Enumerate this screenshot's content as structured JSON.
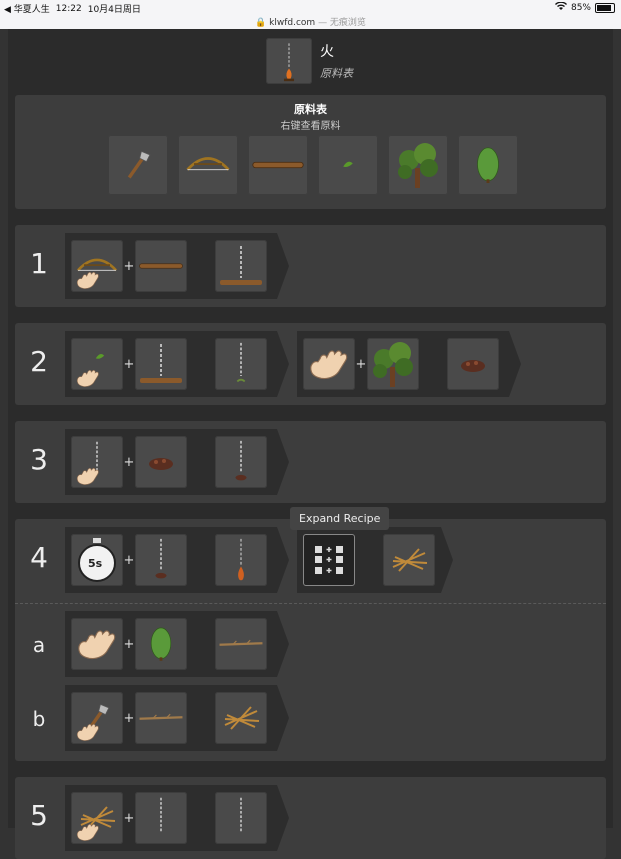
{
  "status_bar": {
    "back_app": "◀ 华夏人生",
    "time": "12:22",
    "date": "10月4日周日",
    "battery": "85%",
    "battery_level": 0.85,
    "url": "klwfd.com",
    "url_suffix": "— 无痕浏览"
  },
  "header": {
    "title": "火",
    "subtitle": "原料表"
  },
  "ingredients": {
    "title": "原料表",
    "hint": "右键查看原料",
    "items": [
      "axe-icon",
      "bow-drill-icon",
      "log-icon",
      "leaf-icon",
      "tree-icon",
      "bush-icon"
    ]
  },
  "steps": [
    {
      "number": "1"
    },
    {
      "number": "2"
    },
    {
      "number": "3"
    },
    {
      "number": "4",
      "timer_label": "5s",
      "tooltip": "Expand Recipe"
    },
    {
      "number": "5"
    }
  ],
  "sub_steps": [
    {
      "label": "a"
    },
    {
      "label": "b"
    }
  ]
}
